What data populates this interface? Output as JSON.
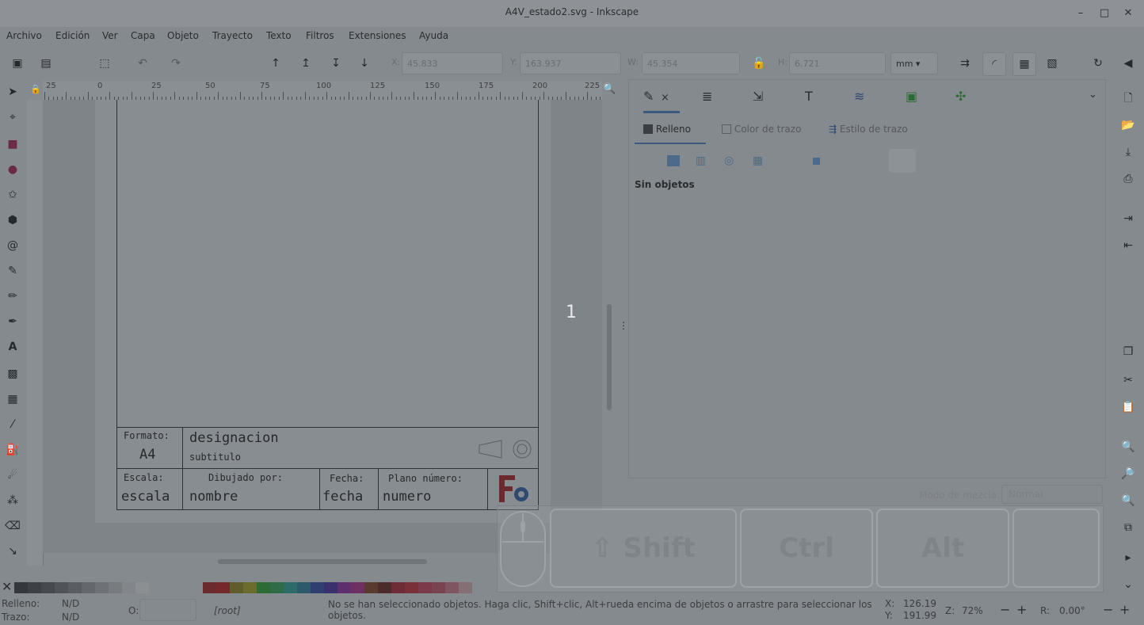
{
  "window": {
    "title": "A4V_estado2.svg - Inkscape",
    "minimize": "–",
    "maximize": "□",
    "close": "✕"
  },
  "menu": [
    "Archivo",
    "Edición",
    "Ver",
    "Capa",
    "Objeto",
    "Trayecto",
    "Texto",
    "Filtros",
    "Extensiones",
    "Ayuda"
  ],
  "toolbar": {
    "x_label": "X:",
    "x_value": "45.833",
    "y_label": "Y:",
    "y_value": "163.937",
    "w_label": "W:",
    "w_value": "45.354",
    "h_label": "H:",
    "h_value": "6.721",
    "unit": "mm"
  },
  "ruler": {
    "labels": [
      "25",
      "0",
      "25",
      "50",
      "75",
      "100",
      "125",
      "150",
      "175",
      "200",
      "225"
    ]
  },
  "tools": [
    "selector-icon",
    "node-icon",
    "rect-icon",
    "circle-icon",
    "star-icon",
    "box3d-icon",
    "spiral-icon",
    "bezier-icon",
    "pencil-icon",
    "calligraphy-icon",
    "text-icon",
    "gradient-icon",
    "mesh-icon",
    "dropper-icon",
    "paintbucket-icon",
    "tweak-icon",
    "spray-icon",
    "eraser-icon",
    "connector-icon"
  ],
  "titleblock": {
    "formato_label": "Formato:",
    "formato_value": "A4",
    "designacion": "designacion",
    "subtitulo": "subtitulo",
    "escala_label": "Escala:",
    "escala_value": "escala",
    "dibujado_label": "Dibujado por:",
    "dibujado_value": "nombre",
    "fecha_label": "Fecha:",
    "fecha_value": "fecha",
    "plano_label": "Plano número:",
    "plano_value": "numero"
  },
  "canvas_marker": "1",
  "panel": {
    "close_x": "×",
    "tabs": {
      "fill": "Relleno",
      "stroke_paint": "Color de trazo",
      "stroke_style": "Estilo de trazo"
    },
    "message": "Sin objetos",
    "blend_label": "Modo de mezcla:",
    "blend_value": "Normal"
  },
  "palette": [
    "#34383c",
    "#3d4145",
    "#46494d",
    "#505357",
    "#5a5d61",
    "#64686b",
    "#6e7175",
    "#787c7f",
    "#828589",
    "#8c8f92",
    "#6a2b2e",
    "#74282c",
    "#5e5d2c",
    "#6b6d2e",
    "#2d6b35",
    "#2e6b46",
    "#2d6b68",
    "#2d5a6b",
    "#2f3f70",
    "#3b306e",
    "#5d2f6e",
    "#6e2f63",
    "#5a3a2e",
    "#4c2b2b",
    "#6e2d36",
    "#7a3039",
    "#7a3a4a",
    "#7a4350",
    "#7e5560",
    "#836f74"
  ],
  "status": {
    "fill_label": "Relleno:",
    "fill_value": "N/D",
    "stroke_label": "Trazo:",
    "stroke_value": "N/D",
    "opacity_label": "O:",
    "layer": "[root]",
    "message": "No se han seleccionado objetos. Haga clic, Shift+clic, Alt+rueda encima de objetos o arrastre para seleccionar los objetos.",
    "x_label": "X:",
    "x_value": "126.19",
    "y_label": "Y:",
    "y_value": "191.99",
    "zoom_label": "Z:",
    "zoom_value": "72%",
    "rotate_label": "R:",
    "rotate_value": "0.00°"
  },
  "keys": {
    "shift": "⇧ Shift",
    "ctrl": "Ctrl",
    "alt": "Alt"
  }
}
